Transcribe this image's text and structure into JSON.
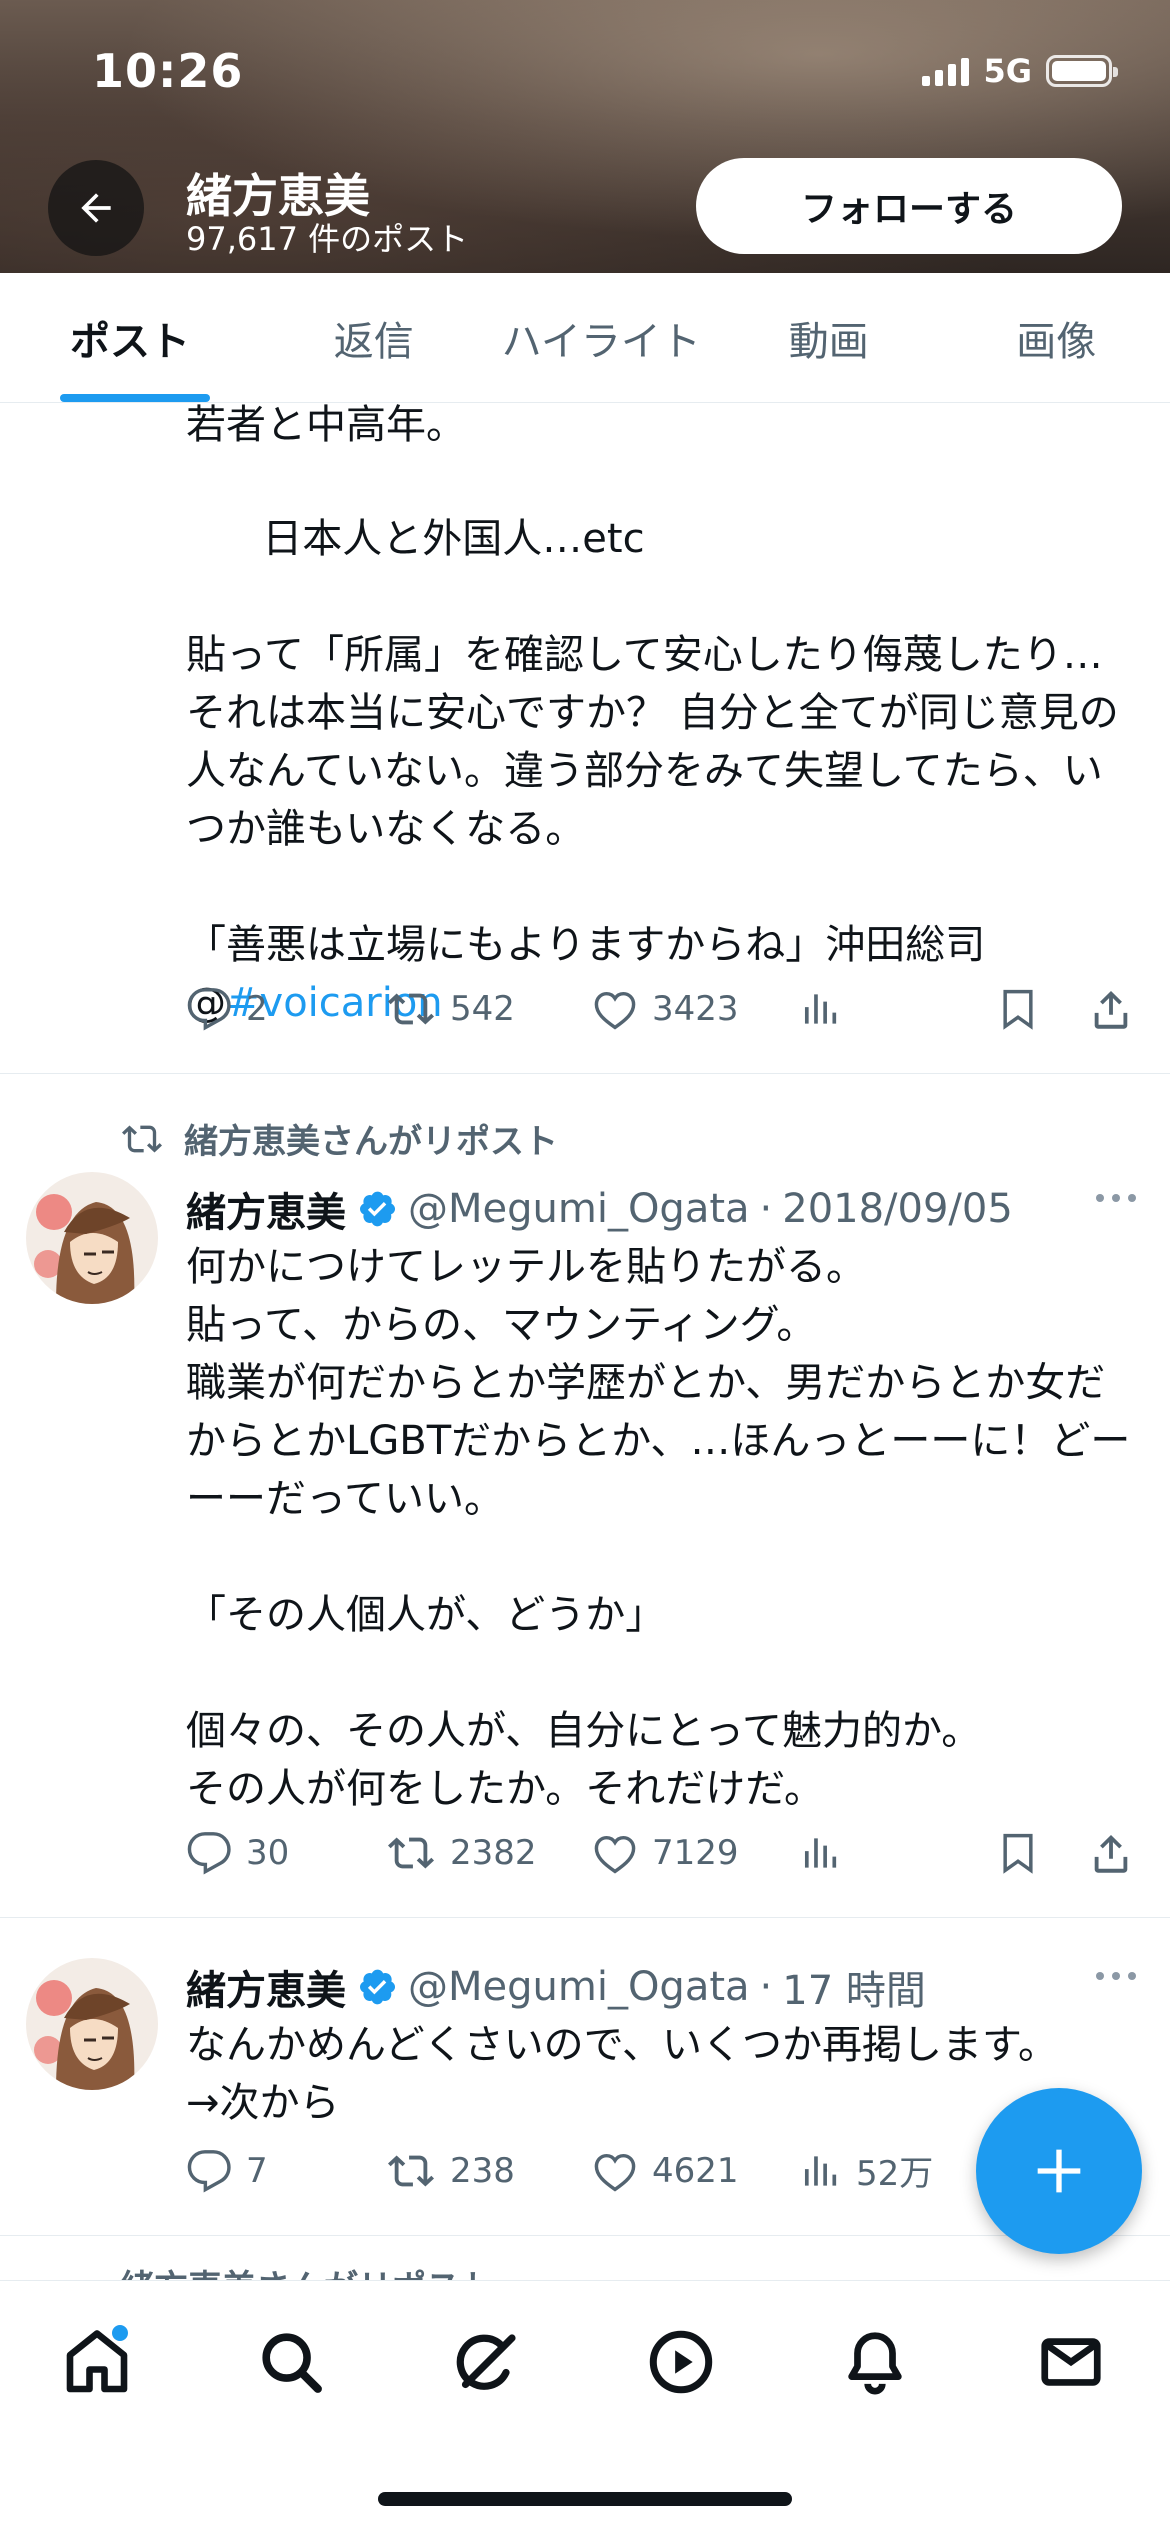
{
  "status_bar": {
    "time": "10:26",
    "network": "5G"
  },
  "profile": {
    "name": "緒方恵美",
    "post_count": "97,617 件のポスト",
    "follow_label": "フォローする"
  },
  "tabs": [
    {
      "label": "ポスト",
      "active": true
    },
    {
      "label": "返信"
    },
    {
      "label": "ハイライト"
    },
    {
      "label": "動画"
    },
    {
      "label": "画像"
    }
  ],
  "posts": [
    {
      "text_partial_top": "若者と中高年。",
      "text": "日本人と外国人…etc\n\n貼って「所属」を確認して安心したり侮蔑したり…それは本当に安心ですか？ 自分と全てが同じ意見の人なんていない。違う部分をみて失望してたら、いつか誰もいなくなる。\n\n「善悪は立場にもよりますからね」沖田総司",
      "mention_prefix": "@",
      "hashtag": "#voicarion",
      "replies": "2",
      "retweets": "542",
      "likes": "3423"
    },
    {
      "repost_label": "緒方恵美さんがリポスト",
      "author": "緒方恵美",
      "handle": "@Megumi_Ogata",
      "date": "2018/09/05",
      "text": "何かにつけてレッテルを貼りたがる。\n貼って、からの、マウンティング。\n職業が何だからとか学歴がとか、男だからとか女だからとかLGBTだからとか、…ほんっとーーに！どーーーだっていい。\n\n「その人個人が、どうか」\n\n個々の、その人が、自分にとって魅力的か。\nその人が何をしたか。それだけだ。",
      "replies": "30",
      "retweets": "2382",
      "likes": "7129"
    },
    {
      "author": "緒方恵美",
      "handle": "@Megumi_Ogata",
      "date": "17 時間",
      "text": "なんかめんどくさいので、いくつか再掲します。\n→次から",
      "replies": "7",
      "retweets": "238",
      "likes": "4621",
      "views": "52万"
    }
  ],
  "next_post_partial": "緒方恵美さんがリポスト",
  "colors": {
    "accent": "#1d9bf0",
    "text": "#0f1419",
    "muted": "#536471",
    "verified": "#1d9bf0"
  },
  "icons": {
    "nav": [
      "home-icon",
      "search-icon",
      "grok-icon",
      "video-icon",
      "bell-icon",
      "mail-icon"
    ],
    "actions": [
      "reply-icon",
      "retweet-icon",
      "like-icon",
      "views-icon",
      "bookmark-icon",
      "share-icon"
    ]
  }
}
